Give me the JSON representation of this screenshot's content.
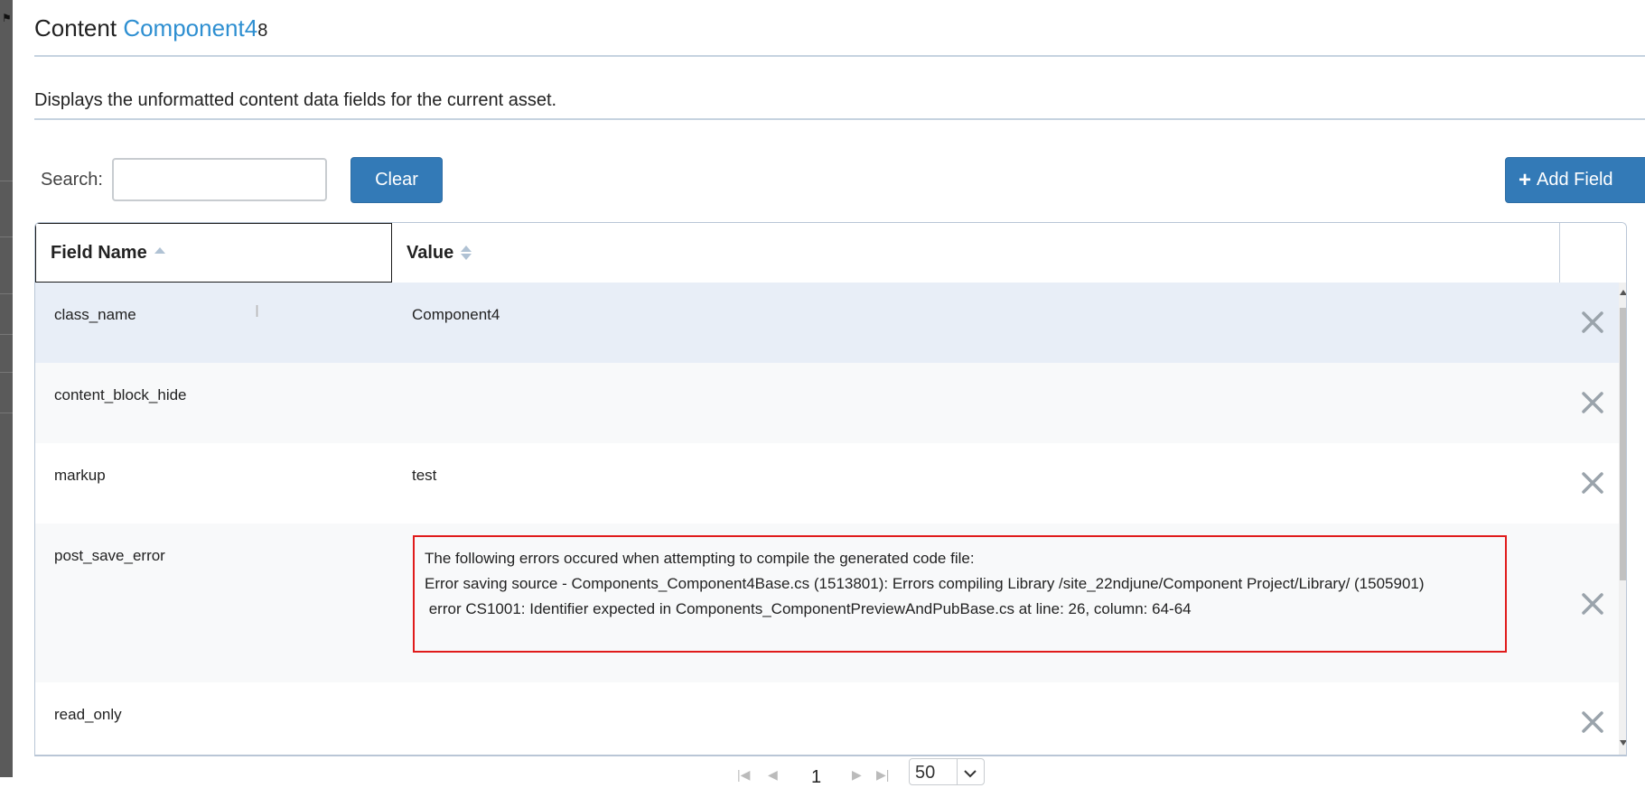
{
  "header": {
    "title_prefix": "Content",
    "title_link": "Component4",
    "title_suffix": "8",
    "description": "Displays the unformatted content data fields for the current asset."
  },
  "toolbar": {
    "search_label": "Search:",
    "search_value": "",
    "clear_label": "Clear",
    "add_field_label": "Add Field"
  },
  "table": {
    "columns": [
      {
        "label": "Field Name",
        "sort": "ascending"
      },
      {
        "label": "Value",
        "sort": "none"
      }
    ],
    "rows": [
      {
        "field": "class_name",
        "value": "Component4"
      },
      {
        "field": "content_block_hide",
        "value": ""
      },
      {
        "field": "markup",
        "value": "test"
      },
      {
        "field": "post_save_error",
        "value_lines": [
          "The following errors occured when attempting to compile the generated code file:",
          "Error saving source - Components_Component4Base.cs (1513801): Errors compiling Library /site_22ndjune/Component Project/Library/ (1505901)",
          " error CS1001: Identifier expected in Components_ComponentPreviewAndPubBase.cs at line: 26, column: 64-64"
        ]
      },
      {
        "field": "read_only",
        "value": ""
      }
    ]
  },
  "pager": {
    "current_page": "1",
    "page_size": "50"
  },
  "colors": {
    "accent": "#2e8fd1",
    "button": "#337ab7",
    "error_border": "#e01b1b",
    "selected_row": "#e8eef7"
  }
}
